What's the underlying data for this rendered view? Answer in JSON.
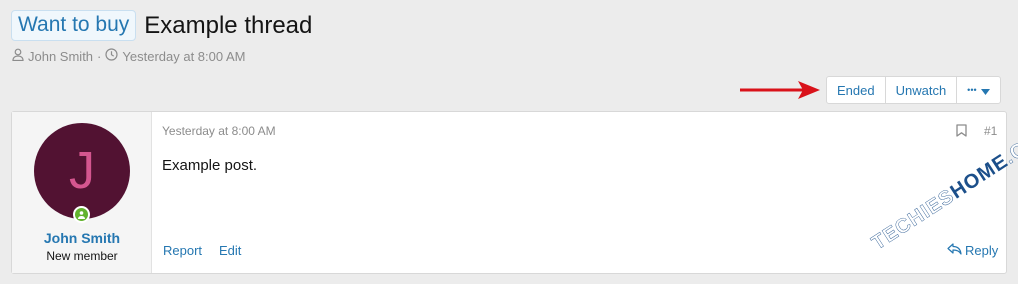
{
  "thread": {
    "prefix": "Want to buy",
    "title": "Example thread",
    "author": "John Smith",
    "separator": "·",
    "date": "Yesterday at 8:00 AM"
  },
  "toolbar": {
    "ended_label": "Ended",
    "unwatch_label": "Unwatch",
    "more_label": "•••"
  },
  "post": {
    "username": "John Smith",
    "user_title": "New member",
    "avatar_letter": "J",
    "date": "Yesterday at 8:00 AM",
    "number": "#1",
    "body": "Example post.",
    "actions": {
      "report": "Report",
      "edit": "Edit",
      "reply": "Reply"
    }
  },
  "watermark": {
    "text_a": "TECHIES",
    "text_b": "HOME",
    "text_c": ".COM"
  },
  "colors": {
    "link": "#2577b1",
    "avatar_bg": "#521232",
    "avatar_letter": "#d4568f",
    "online": "#63b32e",
    "arrow": "#d9121a"
  }
}
